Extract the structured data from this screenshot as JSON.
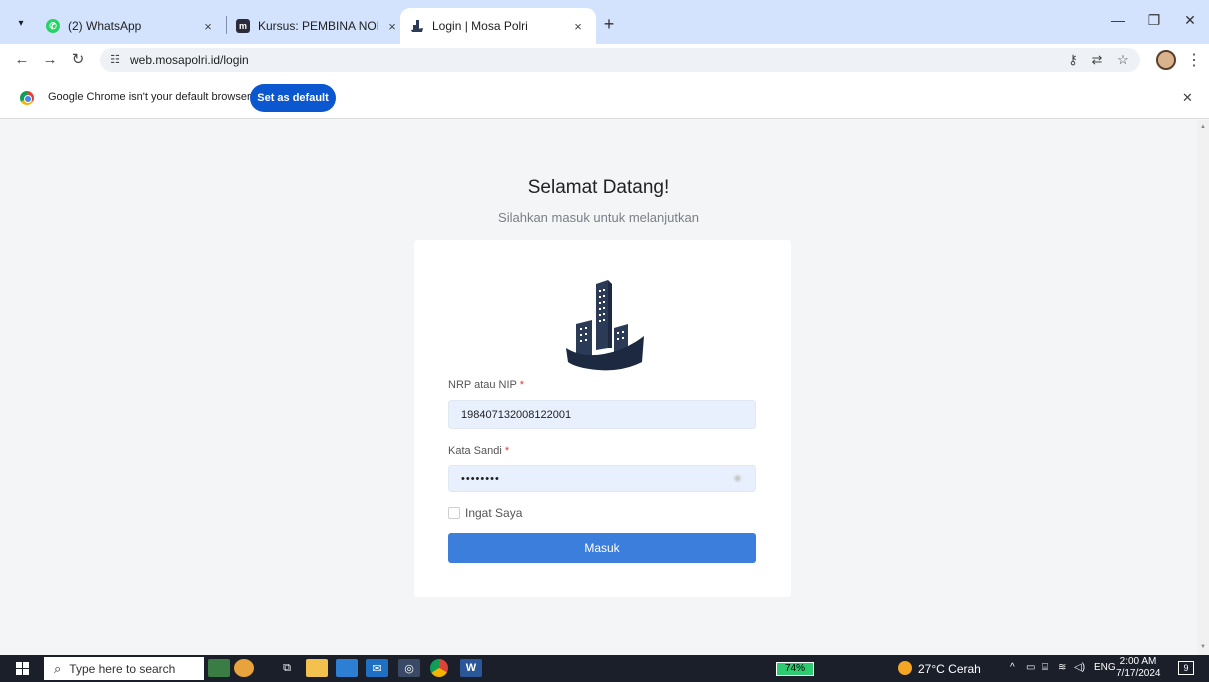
{
  "browser": {
    "tabs": [
      {
        "label": "(2) WhatsApp",
        "icon": "whatsapp-icon",
        "close": "×"
      },
      {
        "label": "Kursus: PEMBINA NOLIK DWI A",
        "icon": "moodle-icon",
        "close": "×"
      },
      {
        "label": "Login | Mosa Polri",
        "icon": "mosa-icon",
        "close": "×"
      }
    ],
    "new_tab": "+",
    "url": "web.mosapolri.id/login",
    "infobar_text": "Google Chrome isn't your default browser",
    "set_default_label": "Set as default"
  },
  "page": {
    "heading": "Selamat Datang!",
    "subheading": "Silahkan masuk untuk melanjutkan",
    "nrp_label": "NRP atau NIP",
    "nrp_value": "198407132008122001",
    "password_label": "Kata Sandi",
    "password_value": "••••••••",
    "required_mark": "*",
    "remember_label": "Ingat Saya",
    "login_button": "Masuk"
  },
  "taskbar": {
    "search_placeholder": "Type here to search",
    "battery": "74%",
    "weather": "27°C  Cerah",
    "language": "ENG",
    "time": "2:00 AM",
    "date": "7/17/2024",
    "notifications": "9"
  },
  "colors": {
    "accent": "#3c7edc",
    "tabstrip": "#d3e3fd",
    "taskbar": "#1b1f2a"
  }
}
